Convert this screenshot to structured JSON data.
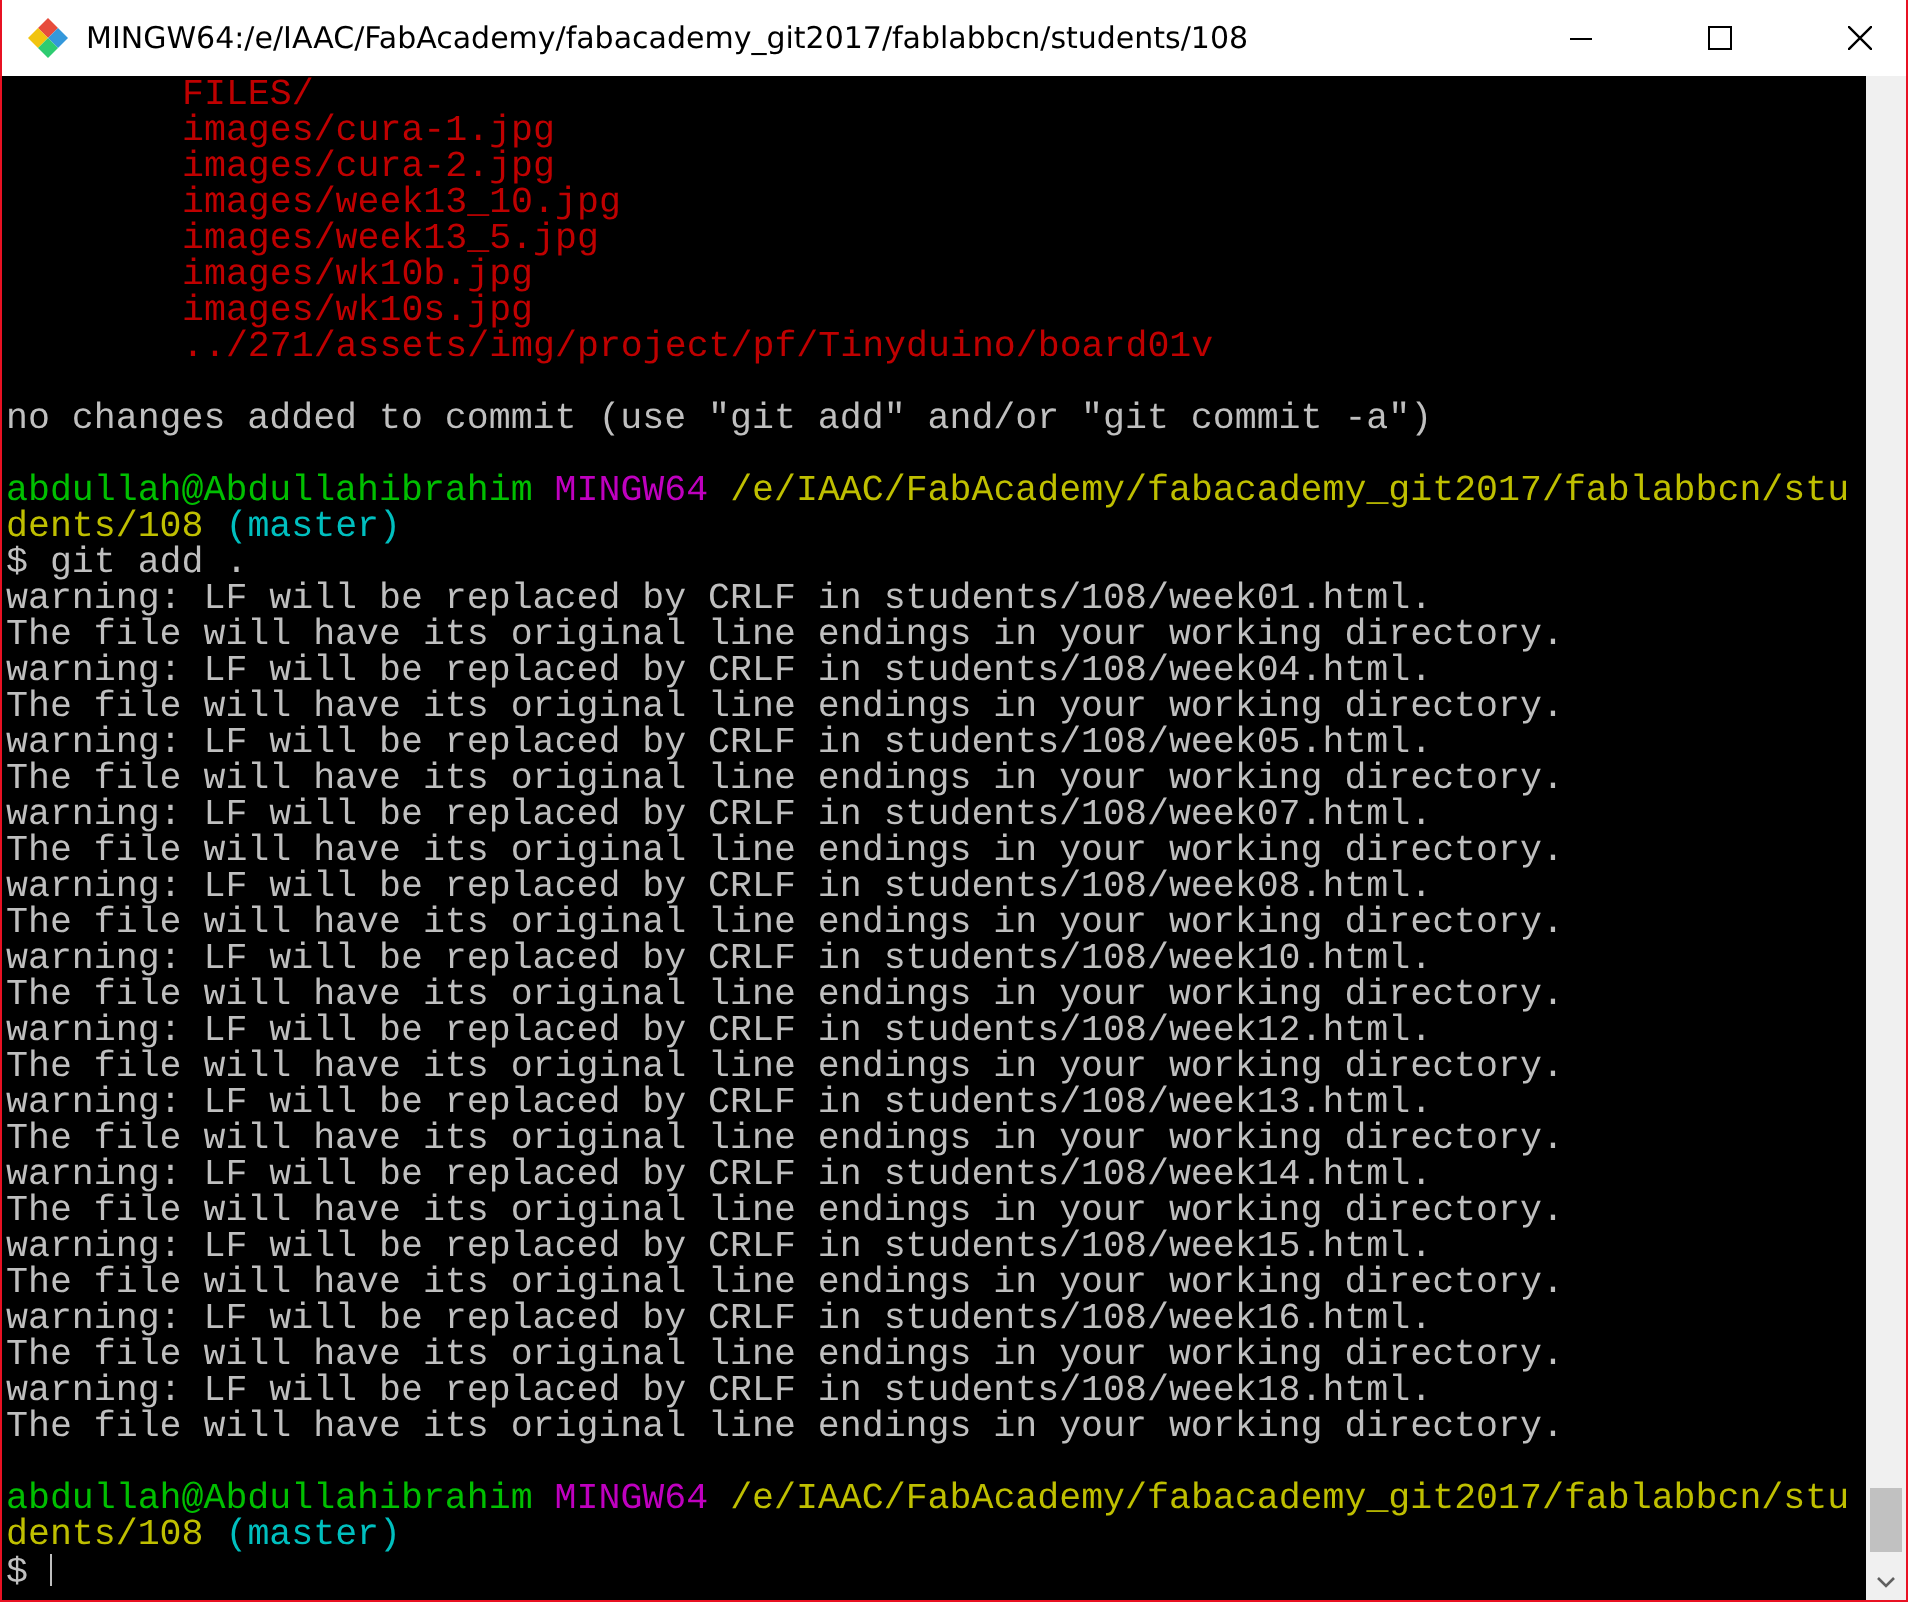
{
  "window": {
    "title": "MINGW64:/e/IAAC/FabAcademy/fabacademy_git2017/fablabbcn/students/108"
  },
  "terminal": {
    "lines": [
      {
        "kind": "untracked",
        "text": "FILES/"
      },
      {
        "kind": "untracked",
        "text": "images/cura-1.jpg"
      },
      {
        "kind": "untracked",
        "text": "images/cura-2.jpg"
      },
      {
        "kind": "untracked",
        "text": "images/week13_10.jpg"
      },
      {
        "kind": "untracked",
        "text": "images/week13_5.jpg"
      },
      {
        "kind": "untracked",
        "text": "images/wk10b.jpg"
      },
      {
        "kind": "untracked",
        "text": "images/wk10s.jpg"
      },
      {
        "kind": "untracked",
        "text": "../271/assets/img/project/pf/Tinyduino/board01v"
      },
      {
        "kind": "blank"
      },
      {
        "kind": "text",
        "text": "no changes added to commit (use \"git add\" and/or \"git commit -a\")"
      },
      {
        "kind": "blank"
      },
      {
        "kind": "prompt",
        "user": "abdullah@Abdullahibrahim",
        "system": "MINGW64",
        "path": "/e/IAAC/FabAcademy/fabacademy_git2017/fablabbcn/students/108",
        "branch": "(master)"
      },
      {
        "kind": "command",
        "text": "$ git add ."
      },
      {
        "kind": "text",
        "text": "warning: LF will be replaced by CRLF in students/108/week01.html."
      },
      {
        "kind": "text",
        "text": "The file will have its original line endings in your working directory."
      },
      {
        "kind": "text",
        "text": "warning: LF will be replaced by CRLF in students/108/week04.html."
      },
      {
        "kind": "text",
        "text": "The file will have its original line endings in your working directory."
      },
      {
        "kind": "text",
        "text": "warning: LF will be replaced by CRLF in students/108/week05.html."
      },
      {
        "kind": "text",
        "text": "The file will have its original line endings in your working directory."
      },
      {
        "kind": "text",
        "text": "warning: LF will be replaced by CRLF in students/108/week07.html."
      },
      {
        "kind": "text",
        "text": "The file will have its original line endings in your working directory."
      },
      {
        "kind": "text",
        "text": "warning: LF will be replaced by CRLF in students/108/week08.html."
      },
      {
        "kind": "text",
        "text": "The file will have its original line endings in your working directory."
      },
      {
        "kind": "text",
        "text": "warning: LF will be replaced by CRLF in students/108/week10.html."
      },
      {
        "kind": "text",
        "text": "The file will have its original line endings in your working directory."
      },
      {
        "kind": "text",
        "text": "warning: LF will be replaced by CRLF in students/108/week12.html."
      },
      {
        "kind": "text",
        "text": "The file will have its original line endings in your working directory."
      },
      {
        "kind": "text",
        "text": "warning: LF will be replaced by CRLF in students/108/week13.html."
      },
      {
        "kind": "text",
        "text": "The file will have its original line endings in your working directory."
      },
      {
        "kind": "text",
        "text": "warning: LF will be replaced by CRLF in students/108/week14.html."
      },
      {
        "kind": "text",
        "text": "The file will have its original line endings in your working directory."
      },
      {
        "kind": "text",
        "text": "warning: LF will be replaced by CRLF in students/108/week15.html."
      },
      {
        "kind": "text",
        "text": "The file will have its original line endings in your working directory."
      },
      {
        "kind": "text",
        "text": "warning: LF will be replaced by CRLF in students/108/week16.html."
      },
      {
        "kind": "text",
        "text": "The file will have its original line endings in your working directory."
      },
      {
        "kind": "text",
        "text": "warning: LF will be replaced by CRLF in students/108/week18.html."
      },
      {
        "kind": "text",
        "text": "The file will have its original line endings in your working directory."
      },
      {
        "kind": "blank"
      },
      {
        "kind": "prompt",
        "user": "abdullah@Abdullahibrahim",
        "system": "MINGW64",
        "path": "/e/IAAC/FabAcademy/fabacademy_git2017/fablabbcn/students/108",
        "branch": "(master)"
      },
      {
        "kind": "input",
        "text": "$"
      }
    ]
  }
}
